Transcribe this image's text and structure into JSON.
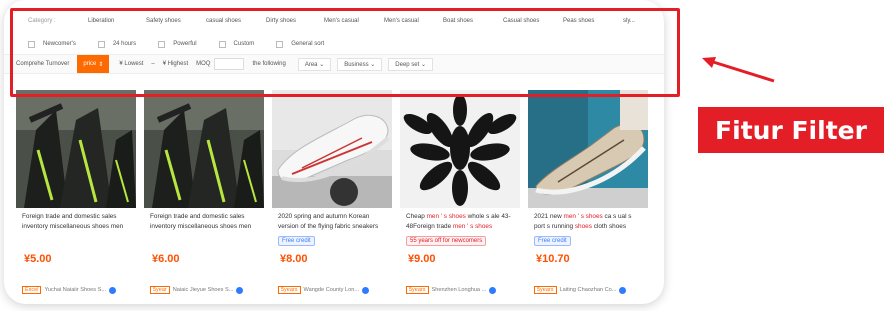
{
  "filters": {
    "categories": [
      "Category :",
      "Liberation",
      "Safety shoes",
      "casual shoes",
      "Dirty shoes",
      "Men's casual",
      "Men's casual",
      "Boat shoes",
      "Casual shoes",
      "Peas shoes",
      "sly..."
    ],
    "checkboxes": [
      "Newcomer's",
      "24 hours",
      "Powerful",
      "Custom",
      "General sort"
    ],
    "sort": {
      "comprehensive": "Comprehe Turnover",
      "price": "price",
      "lowest": "¥ Lowest",
      "highest": "¥ Highest",
      "moq": "MOQ",
      "following": "the following",
      "area": "Area",
      "business": "Business",
      "deep": "Deep set"
    }
  },
  "annotation": {
    "label": "Fitur Filter",
    "color": "#e41e26"
  },
  "products": [
    {
      "title": "Foreign trade and domestic sales inventory miscellaneous shoes men",
      "tag": "",
      "price": "¥5.00",
      "badge": "Excel",
      "seller": "Yuchai Naiaiir Shoes S..."
    },
    {
      "title": "Foreign trade and domestic sales inventory miscellaneous shoes men",
      "tag": "",
      "price": "¥6.00",
      "badge": "5year",
      "seller": "Naiaic Jieyue Shoes S..."
    },
    {
      "title": "2020 spring and autumn Korean version of the flying fabric sneakers",
      "tag": "Free credit",
      "price": "¥8.00",
      "badge": "5years",
      "seller": "Wangde County Lon..."
    },
    {
      "title_pre": "Cheap ",
      "title_hl": "men ' s shoes",
      "title_mid": " whole s ale 43-48Foreign trade ",
      "title_hl2": "men ' s shoes",
      "tag": "55 years off for newcomers",
      "price": "¥9.00",
      "badge": "5years",
      "seller": "Shenzhen Longhua ..."
    },
    {
      "title_pre": "2021 new ",
      "title_hl": "men ' s shoes",
      "title_mid": " ca s ual s port s running ",
      "title_hl2": "shoes",
      "title_end": " cloth shoes",
      "tag": "Free credit",
      "price": "¥10.70",
      "badge": "5years",
      "seller": "Laiting Chaozhan Co..."
    }
  ]
}
